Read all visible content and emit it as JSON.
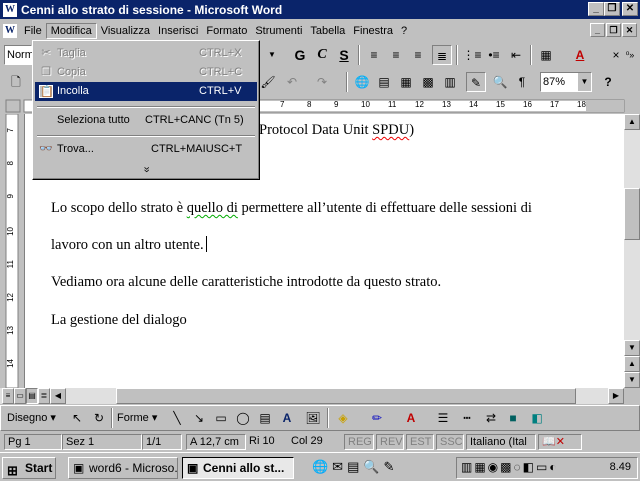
{
  "window": {
    "title": "Cenni allo strato di sessione - Microsoft Word",
    "app_icon": "W"
  },
  "menu": [
    "File",
    "Modifica",
    "Visualizza",
    "Inserisci",
    "Formato",
    "Strumenti",
    "Tabella",
    "Finestra",
    "?"
  ],
  "dropdown": {
    "items": [
      {
        "label": "Taglia",
        "shortcut": "CTRL+X",
        "icon": "scissors-icon",
        "state": "disabled"
      },
      {
        "label": "Copia",
        "shortcut": "CTRL+C",
        "icon": "copy-icon",
        "state": "disabled"
      },
      {
        "label": "Incolla",
        "shortcut": "CTRL+V",
        "icon": "paste-icon",
        "state": "highlighted"
      },
      {
        "label": "Seleziona tutto",
        "shortcut": "CTRL+CANC (Tn 5)",
        "icon": "",
        "state": "normal"
      },
      {
        "label": "Trova...",
        "shortcut": "CTRL+MAIUSC+T",
        "icon": "binoculars-icon",
        "state": "normal"
      }
    ],
    "expand_glyph": "»"
  },
  "toolbar_format": {
    "style_value": "Norm",
    "bold": "G",
    "italic": "C",
    "underline": "S"
  },
  "toolbar_standard": {
    "zoom": "87%"
  },
  "ruler": {
    "labels": [
      "7",
      "8",
      "9",
      "10",
      "11",
      "12",
      "13",
      "14",
      "15",
      "16",
      "17",
      "18"
    ]
  },
  "vruler": {
    "labels": [
      "7",
      "8",
      "9",
      "10",
      "11",
      "12",
      "13",
      "14"
    ]
  },
  "document": {
    "line_partial": "Protocol Data Unit ",
    "line_partial_squig": "SPDU",
    "line_partial_end": ")",
    "p1_a": "Lo scopo dello strato è ",
    "p1_sq": "quello di",
    "p1_b": " permettere all’utente di effettuare delle sessioni di",
    "p2": "lavoro con un altro utente.",
    "p3": "Vediamo ora alcune delle caratteristiche introdotte da questo strato.",
    "p4": "La gestione del dialogo"
  },
  "drawbar": {
    "disegno": "Disegno",
    "forme": "Forme"
  },
  "status": {
    "page": "Pg 1",
    "section": "Sez 1",
    "pages": "1/1",
    "position": "A  12,7 cm",
    "line": "Ri  10",
    "col": "Col  29",
    "rec": "REG",
    "rev": "REV",
    "est": "EST",
    "ssc": "SSC",
    "lang": "Italiano (Ital"
  },
  "taskbar": {
    "start": "Start",
    "tasks": [
      "word6 - Microso...",
      "Cenni allo st..."
    ],
    "clock": "8.49"
  }
}
